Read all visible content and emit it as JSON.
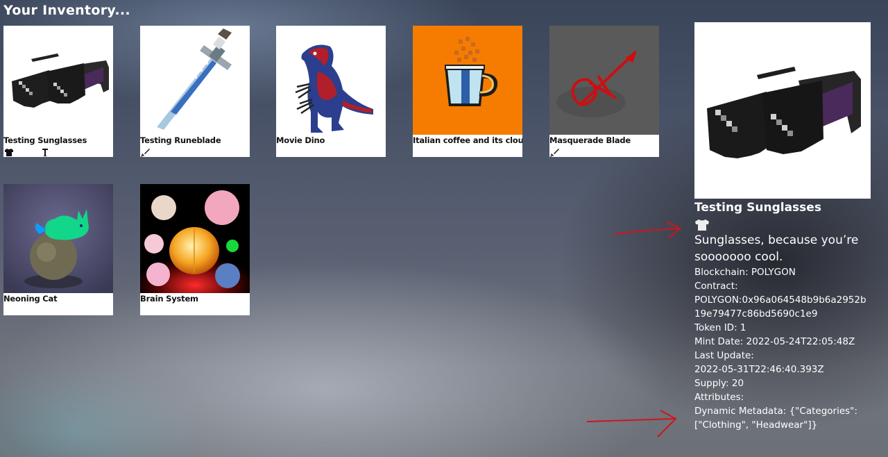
{
  "page": {
    "title": "Your Inventory..."
  },
  "inventory": {
    "items": [
      {
        "name": "Testing Sunglasses",
        "icons": [
          "shirt-icon",
          "hanger-icon"
        ]
      },
      {
        "name": "Testing Runeblade",
        "icons": [
          "sword-icon"
        ]
      },
      {
        "name": "Movie Dino",
        "icons": []
      },
      {
        "name": "Italian coffee and its cloud",
        "icons": []
      },
      {
        "name": "Masquerade Blade",
        "icons": [
          "sword-icon"
        ]
      },
      {
        "name": "Neoning Cat",
        "icons": []
      },
      {
        "name": "Brain System",
        "icons": []
      }
    ]
  },
  "detail": {
    "name": "Testing Sunglasses",
    "category_icon": "shirt-icon",
    "description": "Sunglasses, because you’re sooooooo cool.",
    "blockchain": "Blockchain: POLYGON",
    "contract_label": "Contract:",
    "contract_value": "POLYGON:0x96a064548b9b6a2952b19e79477c86bd5690c1e9",
    "token_id": "Token ID: 1",
    "mint_date": "Mint Date: 2022-05-24T22:05:48Z",
    "last_update_label": "Last Update:",
    "last_update_value": "2022-05-31T22:46:40.393Z",
    "supply": "Supply: 20",
    "attributes": "Attributes:",
    "dynamic_metadata": "Dynamic Metadata: {\"Categories\": [\"Clothing\", \"Headwear\"]}"
  },
  "colors": {
    "accent_arrow": "#d0141c",
    "card_background": "#ffffff",
    "text": "#ffffff"
  }
}
